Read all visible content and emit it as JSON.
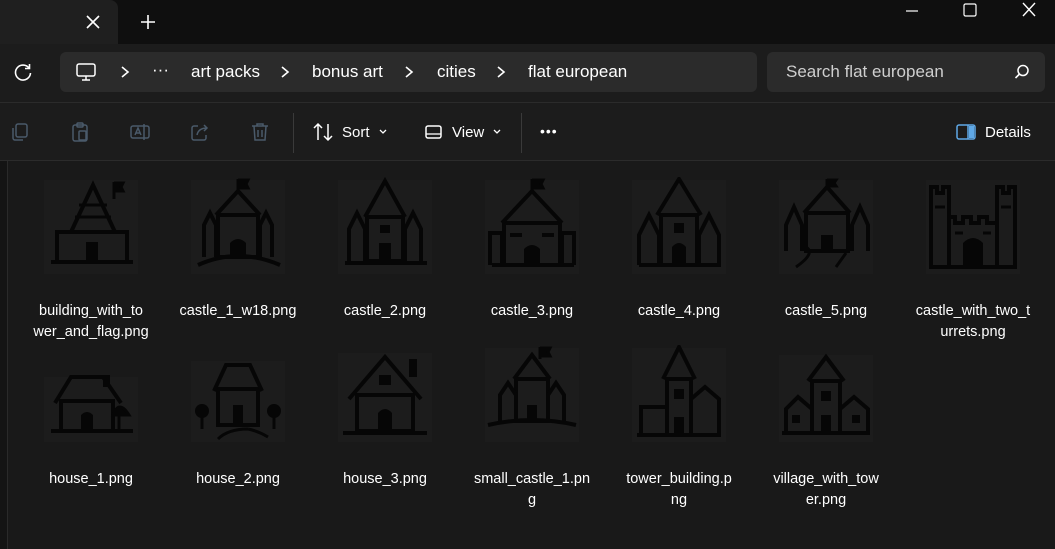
{
  "window": {
    "new_tab_symbol": "+",
    "tab_close_icon": "close-icon"
  },
  "address": {
    "overflow": "···",
    "crumbs": [
      "art packs",
      "bonus art",
      "cities",
      "flat european"
    ]
  },
  "search": {
    "placeholder": "Search flat european"
  },
  "toolbar": {
    "sort_label": "Sort",
    "view_label": "View",
    "more_label": "•••",
    "details_label": "Details"
  },
  "files": [
    {
      "name": "building_with_tower_and_flag.png",
      "line1": "building_with_to",
      "line2": "wer_and_flag.png",
      "icon": "castle-flag-thumbnail"
    },
    {
      "name": "castle_1_w18.png",
      "line1": "castle_1_w18.png",
      "line2": "",
      "icon": "castle-thumbnail"
    },
    {
      "name": "castle_2.png",
      "line1": "castle_2.png",
      "line2": "",
      "icon": "castle-thumbnail"
    },
    {
      "name": "castle_3.png",
      "line1": "castle_3.png",
      "line2": "",
      "icon": "castle-thumbnail"
    },
    {
      "name": "castle_4.png",
      "line1": "castle_4.png",
      "line2": "",
      "icon": "castle-thumbnail"
    },
    {
      "name": "castle_5.png",
      "line1": "castle_5.png",
      "line2": "",
      "icon": "castle-thumbnail"
    },
    {
      "name": "castle_with_two_turrets.png",
      "line1": "castle_with_two_t",
      "line2": "urrets.png",
      "icon": "castle-turrets-thumbnail"
    },
    {
      "name": "house_1.png",
      "line1": "house_1.png",
      "line2": "",
      "icon": "house-thumbnail"
    },
    {
      "name": "house_2.png",
      "line1": "house_2.png",
      "line2": "",
      "icon": "house-thumbnail"
    },
    {
      "name": "house_3.png",
      "line1": "house_3.png",
      "line2": "",
      "icon": "house-thumbnail"
    },
    {
      "name": "small_castle_1.png",
      "line1": "small_castle_1.pn",
      "line2": "g",
      "icon": "castle-thumbnail"
    },
    {
      "name": "tower_building.png",
      "line1": "tower_building.p",
      "line2": "ng",
      "icon": "tower-thumbnail"
    },
    {
      "name": "village_with_tower.png",
      "line1": "village_with_tow",
      "line2": "er.png",
      "icon": "village-thumbnail"
    }
  ]
}
